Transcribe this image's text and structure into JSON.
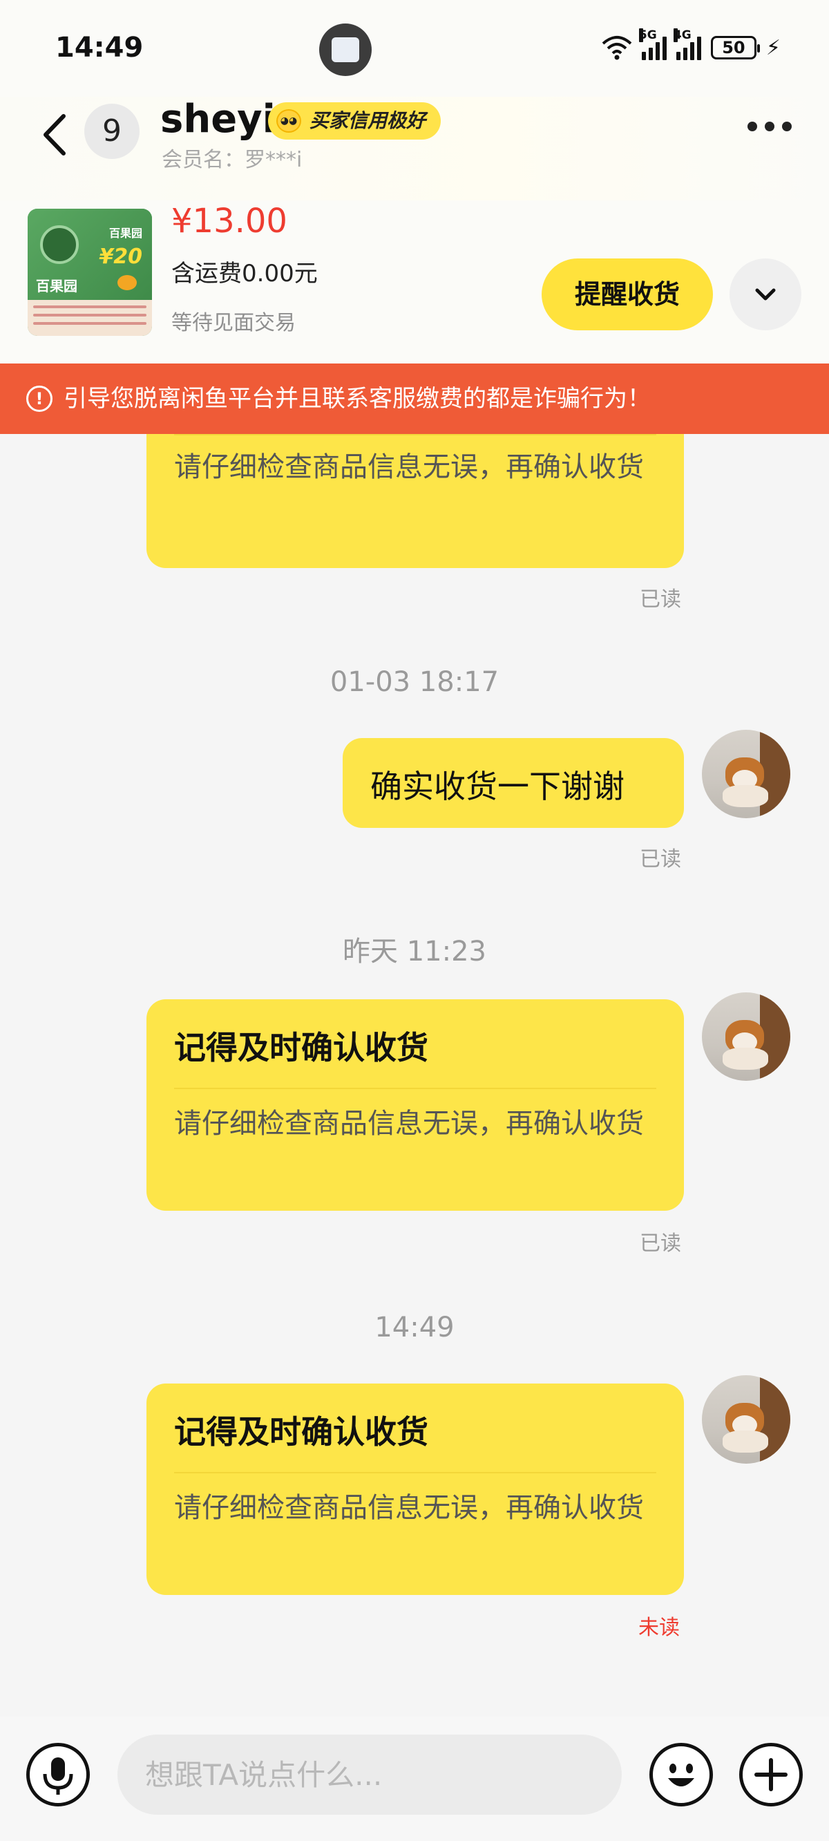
{
  "status_bar": {
    "time": "14:49",
    "net1": "5G",
    "net2": "4G",
    "battery": "50"
  },
  "header": {
    "unread_count": "9",
    "seller_name": "sheyi",
    "credit_badge": "买家信用极好",
    "member_label": "会员名：罗***i"
  },
  "product": {
    "price": "¥13.00",
    "shipping": "含运费0.00元",
    "status": "等待见面交易",
    "thumb_brand": "百果园",
    "thumb_price": "¥20",
    "remind_button": "提醒收货"
  },
  "warning": {
    "text": "引导您脱离闲鱼平台并且联系客服缴费的都是诈骗行为！"
  },
  "messages": [
    {
      "body": "请仔细检查商品信息无误，再确认收货",
      "read": "已读"
    },
    {
      "timestamp": "01-03 18:17",
      "text": "确实收货一下谢谢",
      "read": "已读"
    },
    {
      "timestamp": "昨天 11:23",
      "title": "记得及时确认收货",
      "body": "请仔细检查商品信息无误，再确认收货",
      "read": "已读"
    },
    {
      "timestamp": "14:49",
      "title": "记得及时确认收货",
      "body": "请仔细检查商品信息无误，再确认收货",
      "read": "未读"
    }
  ],
  "input": {
    "placeholder": "想跟TA说点什么..."
  },
  "colors": {
    "accent_yellow": "#fde549",
    "warning_red": "#ef5b37",
    "price_red": "#ee3c30"
  }
}
